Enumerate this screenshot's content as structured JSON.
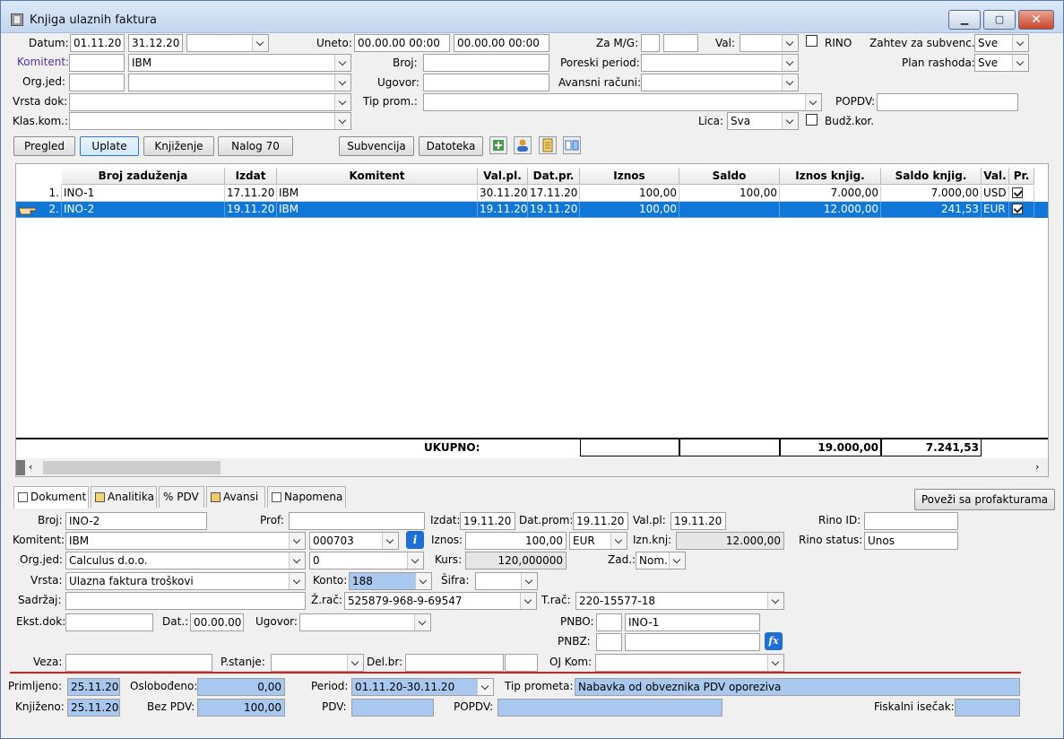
{
  "window": {
    "title": "Knjiga ulaznih faktura",
    "min": "▁",
    "max": "▢",
    "close": "✕"
  },
  "filters": {
    "datum_label": "Datum:",
    "datum_from": "01.11.20",
    "datum_to": "31.12.20",
    "datum_combo": "",
    "uneto_label": "Uneto:",
    "uneto_from": "00.00.00 00:00",
    "uneto_to": "00.00.00 00:00",
    "zamg_label": "Za M/G:",
    "zamg_m": "",
    "zamg_g": "",
    "val_label": "Val:",
    "val_value": "",
    "rino_label": "RINO",
    "zahtev_label": "Zahtev za subvenc.:",
    "zahtev_value": "Sve",
    "komitent_label": "Komitent:",
    "komitent_code": "",
    "komitent_name": "IBM",
    "broj_label": "Broj:",
    "broj_value": "",
    "poreski_label": "Poreski period:",
    "poreski_value": "",
    "plan_label": "Plan rashoda:",
    "plan_value": "Sve",
    "orgjed_label": "Org.jed:",
    "orgjed_code": "",
    "orgjed_name": "",
    "ugovor_label": "Ugovor:",
    "ugovor_value": "",
    "avansni_label": "Avansni računi:",
    "avansni_value": "",
    "vrstadok_label": "Vrsta dok:",
    "vrstadok_value": "",
    "tipprom_label": "Tip prom.:",
    "tipprom_value": "",
    "popdv_label": "POPDV:",
    "popdv_value": "",
    "klaskom_label": "Klas.kom.:",
    "klaskom_value": "",
    "lica_label": "Lica:",
    "lica_value": "Sva",
    "budz_label": "Budž.kor."
  },
  "toolbar": {
    "pregled": "Pregled",
    "uplate": "Uplate",
    "knjizenje": "Knjiženje",
    "nalog": "Nalog 70",
    "subvencija": "Subvencija",
    "datoteka": "Datoteka"
  },
  "grid": {
    "headers": [
      "Broj zaduženja",
      "Izdat",
      "Komitent",
      "Val.pl.",
      "Dat.pr.",
      "Iznos",
      "Saldo",
      "Iznos knjig.",
      "Saldo knjig.",
      "Val.",
      "Pr."
    ],
    "rows": [
      {
        "n": "1.",
        "broj": "INO-1",
        "izdat": "17.11.20",
        "komitent": "IBM",
        "valpl": "30.11.20",
        "datpr": "17.11.20",
        "iznos": "100,00",
        "saldo": "100,00",
        "iznosk": "7.000,00",
        "saldok": "7.000,00",
        "val": "USD"
      },
      {
        "n": "2.",
        "broj": "INO-2",
        "izdat": "19.11.20",
        "komitent": "IBM",
        "valpl": "19.11.20",
        "datpr": "19.11.20",
        "iznos": "100,00",
        "saldo": "",
        "iznosk": "12.000,00",
        "saldok": "241,53",
        "val": "EUR"
      }
    ],
    "total_label": "UKUPNO:",
    "total_iznosk": "19.000,00",
    "total_saldok": "7.241,53"
  },
  "tabs": [
    "Dokument",
    "Analitika",
    "PDV",
    "Avansi",
    "Napomena"
  ],
  "povezi": "Poveži sa profakturama",
  "detail": {
    "broj_l": "Broj:",
    "broj": "INO-2",
    "prof_l": "Prof:",
    "prof": "",
    "izdat_l": "Izdat:",
    "izdat": "19.11.20",
    "datprom_l": "Dat.prom:",
    "datprom": "19.11.20",
    "valpl_l": "Val.pl:",
    "valpl": "19.11.20",
    "rinoid_l": "Rino ID:",
    "rinoid": "",
    "kom_l": "Komitent:",
    "kom": "IBM",
    "komcode": "000703",
    "iznos_l": "Iznos:",
    "iznos": "100,00",
    "valuta": "EUR",
    "iznknj_l": "Izn.knj:",
    "iznknj": "12.000,00",
    "rinost_l": "Rino status:",
    "rinost": "Unos",
    "org_l": "Org.jed:",
    "org": "Calculus d.o.o.",
    "orgcode": "0",
    "kurs_l": "Kurs:",
    "kurs": "120,000000",
    "zad_l": "Zad.:",
    "zad": "Nom.",
    "vrsta_l": "Vrsta:",
    "vrsta": "Ulazna faktura troškovi",
    "konto_l": "Konto:",
    "konto": "188",
    "sifra_l": "Šifra:",
    "sifra": "",
    "sadrzaj_l": "Sadržaj:",
    "sadrzaj": "",
    "zrac_l": "Ž.rač:",
    "zrac": "525879-968-9-69547",
    "trac_l": "T.rač:",
    "trac": "220-15577-18",
    "ekst_l": "Ekst.dok:",
    "ekst": "",
    "dat_l": "Dat.:",
    "dat": "00.00.00",
    "ugov_l": "Ugovor:",
    "ugov": "",
    "pnbo_l": "PNBO:",
    "pnbo1": "",
    "pnbo2": "INO-1",
    "pnbz_l": "PNBZ:",
    "pnbz1": "",
    "pnbz2": "",
    "veza_l": "Veza:",
    "veza": "",
    "pst_l": "P.stanje:",
    "pst": "",
    "delbr_l": "Del.br:",
    "delbr1": "",
    "delbr2": "",
    "ojkom_l": "OJ Kom:",
    "ojkom": ""
  },
  "footer": {
    "primljeno_l": "Primljeno:",
    "primljeno": "25.11.20",
    "oslob_l": "Oslobođeno:",
    "oslob": "0,00",
    "period_l": "Period:",
    "period": "01.11.20-30.11.20",
    "tipprom_l": "Tip prometa:",
    "tipprom": "Nabavka od obveznika PDV oporeziva",
    "knjizeno_l": "Knjiženo:",
    "knjizeno": "25.11.20",
    "bezpdv_l": "Bez PDV:",
    "bezpdv": "100,00",
    "pdv_l": "PDV:",
    "pdv": "",
    "popdv_l": "POPDV:",
    "popdv": "",
    "fisk_l": "Fiskalni isečak:",
    "fisk": ""
  },
  "colors": {
    "selection": "#0f77d8",
    "field_blue": "#a9c8ef",
    "separator": "#d42020"
  }
}
